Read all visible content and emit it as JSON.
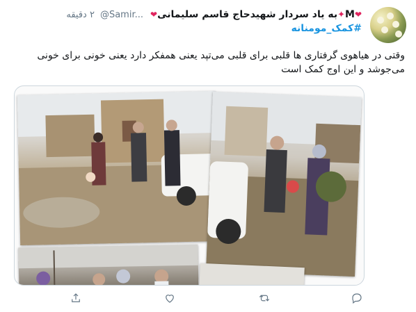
{
  "tweet": {
    "display_name": "به یاد سردار شهیدحاج قاسم سلیمانی",
    "display_name_letter": "M",
    "handle": "@Samir...",
    "time": "۲ دقیقه",
    "hashtag": "#کمک_مومنانه",
    "body": "وقتی در هیاهوی گرفتاری ها قلبی برای قلبی می‌تپد یعنی همفکر دارد یعنی خونی برای خونی می‌جوشد و این اوج کمک است"
  },
  "colors": {
    "link": "#1b95e0",
    "muted": "#657786",
    "heart": "#e0245e",
    "border": "#ccd6dd"
  },
  "icons": [
    "reply-icon",
    "retweet-icon",
    "like-icon",
    "share-icon"
  ]
}
